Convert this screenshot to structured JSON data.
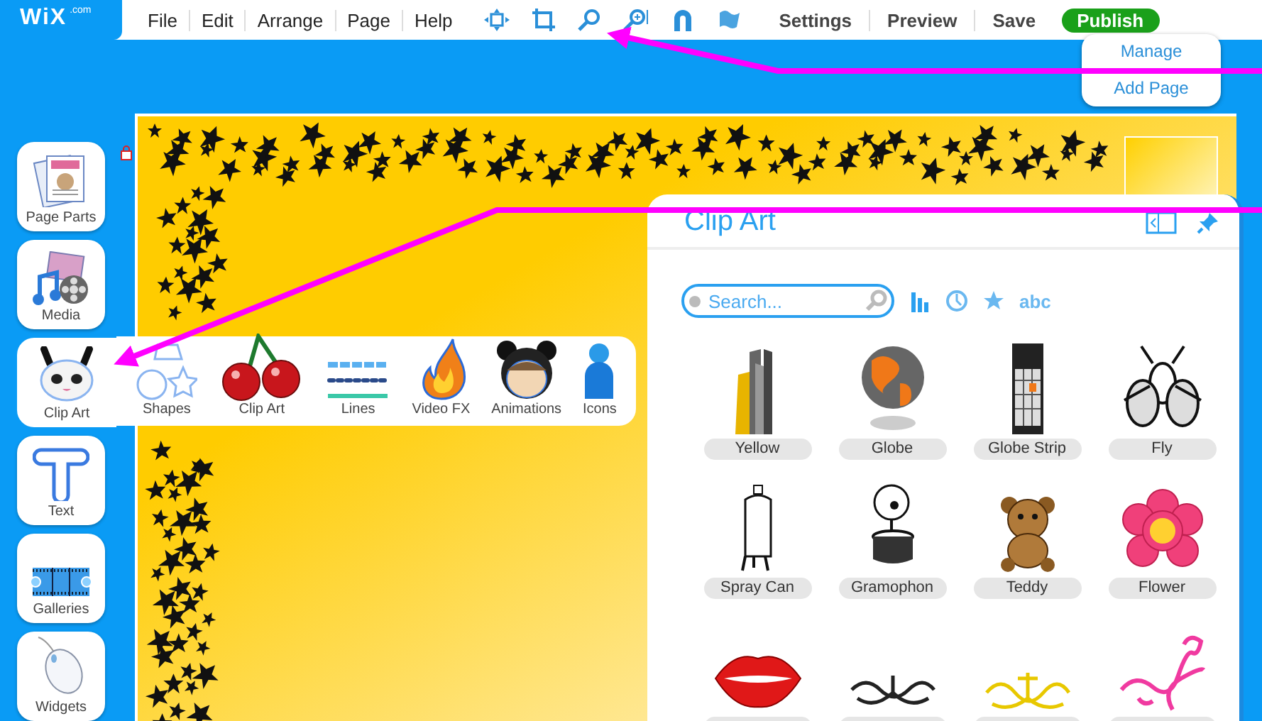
{
  "logo": {
    "name": "WiX",
    "suffix": ".com"
  },
  "menu": [
    "File",
    "Edit",
    "Arrange",
    "Page",
    "Help"
  ],
  "toolbar_icons": [
    {
      "kind": "move"
    },
    {
      "kind": "resize"
    },
    {
      "kind": "zoom-out"
    },
    {
      "kind": "zoom-in"
    },
    {
      "kind": "magnet"
    },
    {
      "kind": "flag"
    }
  ],
  "actions": [
    "Settings",
    "Preview",
    "Save"
  ],
  "publish": "Publish",
  "page_menu": [
    "Manage",
    "Add Page"
  ],
  "sidebar": [
    {
      "label": "Page Parts",
      "kind": "page-parts",
      "selected": false
    },
    {
      "label": "Media",
      "kind": "media",
      "selected": false
    },
    {
      "label": "Clip Art",
      "kind": "clip-art",
      "selected": true
    },
    {
      "label": "Text",
      "kind": "text",
      "selected": false
    },
    {
      "label": "Galleries",
      "kind": "galleries",
      "selected": false
    },
    {
      "label": "Widgets",
      "kind": "widgets",
      "selected": false
    }
  ],
  "flyout": [
    {
      "label": "Shapes",
      "kind": "shapes"
    },
    {
      "label": "Clip Art",
      "kind": "cherries"
    },
    {
      "label": "Lines",
      "kind": "lines"
    },
    {
      "label": "Video FX",
      "kind": "flame"
    },
    {
      "label": "Animations",
      "kind": "character"
    },
    {
      "label": "Icons",
      "kind": "person"
    }
  ],
  "panel": {
    "title": "Clip Art",
    "search": {
      "placeholder": "Search..."
    },
    "sort_label": "abc",
    "items": [
      {
        "label": "Yellow",
        "kind": "towers"
      },
      {
        "label": "Globe",
        "kind": "globe"
      },
      {
        "label": "Globe Strip",
        "kind": "strip"
      },
      {
        "label": "Fly",
        "kind": "fly"
      },
      {
        "label": "Spray Can",
        "kind": "spray"
      },
      {
        "label": "Gramophon",
        "kind": "gramophone"
      },
      {
        "label": "Teddy",
        "kind": "teddy"
      },
      {
        "label": "Flower",
        "kind": "flower"
      },
      {
        "kind": "lips"
      },
      {
        "kind": "ornament-black"
      },
      {
        "kind": "ornament-gold"
      },
      {
        "kind": "swirl"
      }
    ]
  }
}
